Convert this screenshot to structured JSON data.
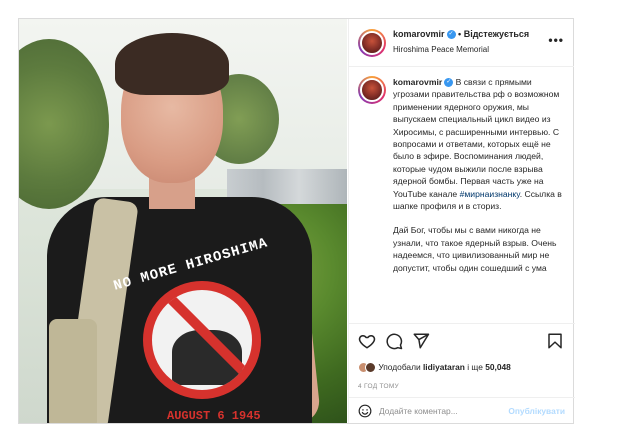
{
  "post": {
    "username": "komarovmir",
    "follow_label": "Відстежується",
    "location": "Hiroshima Peace Memorial",
    "more_icon": "more-horizontal-icon",
    "verified_icon": "verified-badge-icon"
  },
  "photo": {
    "shirt_text": "NO MORE HIROSHIMA",
    "date_text": "AUGUST 6 1945"
  },
  "caption": {
    "username": "komarovmir",
    "paragraph1_before_tag": "В связи с прямыми угрозами правительства рф о возможном применении ядерного оружия, мы выпускаем специальный цикл видео из Хиросимы, с расширенными интервью. С вопросами и ответами, которых ещё не было в эфире. Воспоминания людей, которые чудом выжили после взрыва ядерной бомбы. Первая часть уже на YouTube канале",
    "hashtag": "#мирнаизнанку",
    "paragraph1_after_tag": ". Ссылка в шапке профиля и в сториз.",
    "paragraph2": "Дай Бог, чтобы мы с вами никогда не узнали, что такое ядерный взрыв. Очень надеемся, что цивилизованный мир не допустит, чтобы один сошедший с ума"
  },
  "actions": {
    "like_icon": "heart-icon",
    "comment_icon": "comment-icon",
    "share_icon": "share-icon",
    "save_icon": "bookmark-icon"
  },
  "likes": {
    "prefix": "Уподобали",
    "user": "lidiyataran",
    "suffix": "і ще",
    "count": "50,048"
  },
  "time_ago": "4 ГОД ТОМУ",
  "comment": {
    "placeholder": "Додайте коментар...",
    "publish_label": "Опублікувати",
    "emoji_icon": "emoji-icon"
  },
  "colors": {
    "verified": "#3897f0",
    "hashtag": "#00376b",
    "publish_disabled": "#b3dbff",
    "muted": "#8e8e8e"
  }
}
